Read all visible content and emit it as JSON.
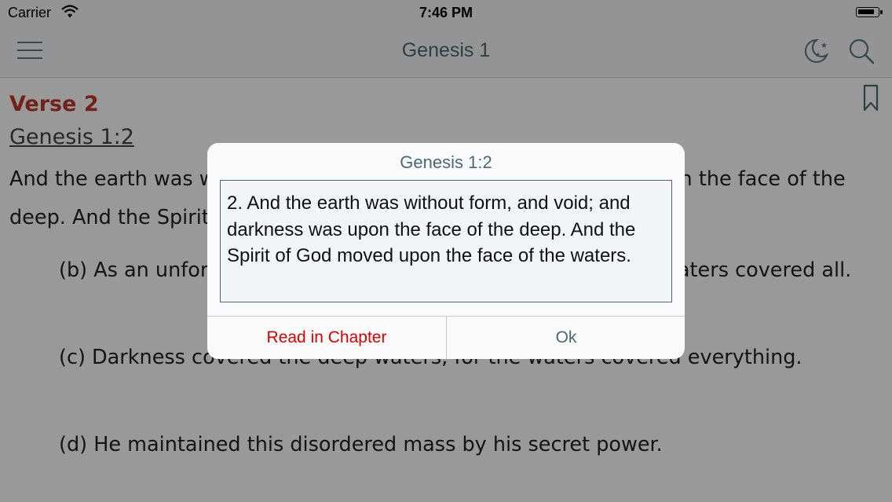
{
  "status_bar": {
    "carrier": "Carrier",
    "time": "7:46 PM"
  },
  "nav": {
    "title": "Genesis 1",
    "icons": [
      "menu-icon",
      "night-mode-icon",
      "search-icon"
    ]
  },
  "content": {
    "verse_heading": "Verse 2",
    "verse_ref": "Genesis 1:2",
    "verse_text": "And the earth was without form, and void; and darkness [was] upon the face of the deep. And the Spirit of God moved upon the face of the waters.",
    "notes": [
      "(b) As an unformed lump, and without any creature: for the waters covered all.",
      "(c) Darkness covered the deep waters, for the waters covered everything.",
      "(d) He maintained this disordered mass by his secret power."
    ],
    "bookmark_icon": "bookmark-icon"
  },
  "alert": {
    "title": "Genesis 1:2",
    "body": "2. And the earth was without form, and void; and darkness was upon the face of the deep. And the Spirit of God moved upon the face of the waters.",
    "buttons": {
      "read_in_chapter": "Read in Chapter",
      "ok": "Ok"
    }
  },
  "colors": {
    "accent": "#486a73",
    "verse_heading": "#c0392b",
    "destructive": "#e00000"
  }
}
